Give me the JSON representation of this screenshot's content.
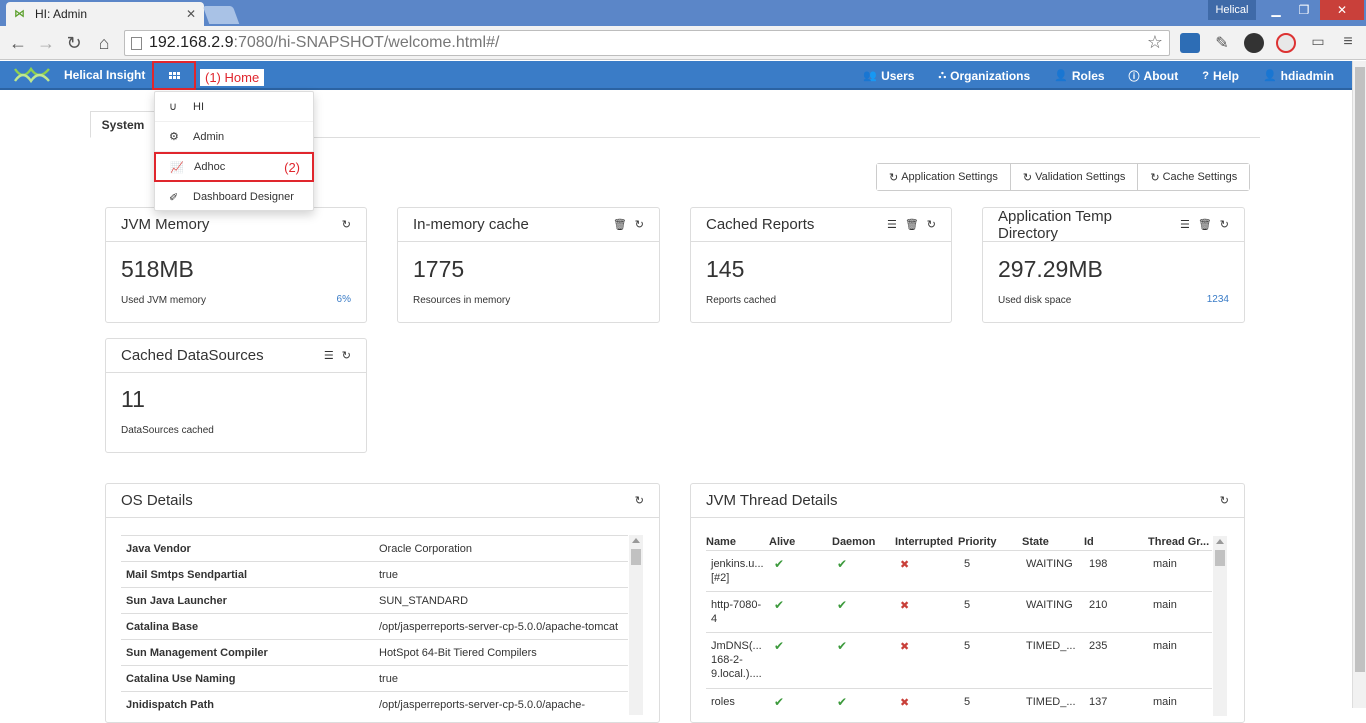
{
  "browser": {
    "tab_title": "HI: Admin",
    "tab_close": "✕",
    "profile_name": "Helical",
    "url_host": "192.168.2.9",
    "url_rest": ":7080/hi-SNAPSHOT/welcome.html#/"
  },
  "app": {
    "brand": "Helical Insight",
    "annotation_home": "(1) Home",
    "nav": {
      "users": "Users",
      "organizations": "Organizations",
      "roles": "Roles",
      "about": "About",
      "help": "Help",
      "user": "hdiadmin"
    },
    "colors": {
      "accent": "#3a7cc7",
      "highlight": "#e0262d",
      "ok": "#3c9a3c",
      "error": "#c9403a"
    }
  },
  "dropdown": {
    "items": [
      {
        "label": "HI",
        "icon": "magnet-icon"
      },
      {
        "label": "Admin",
        "icon": "cogs-icon"
      },
      {
        "label": "Adhoc",
        "icon": "line-chart-icon",
        "annotation": "(2)"
      },
      {
        "label": "Dashboard Designer",
        "icon": "magic-wand-icon"
      }
    ]
  },
  "tabs": {
    "system": "System"
  },
  "settings_buttons": {
    "application": "Application Settings",
    "validation": "Validation Settings",
    "cache": "Cache Settings"
  },
  "cards": {
    "jvm_memory": {
      "title": "JVM Memory",
      "value": "518MB",
      "label": "Used JVM memory",
      "extra": "6%"
    },
    "inmemory_cache": {
      "title": "In-memory cache",
      "value": "1775",
      "label": "Resources in memory"
    },
    "cached_reports": {
      "title": "Cached Reports",
      "value": "145",
      "label": "Reports cached"
    },
    "temp_dir": {
      "title": "Application Temp Directory",
      "value": "297.29MB",
      "label": "Used disk space",
      "extra": "1234"
    },
    "cached_datasources": {
      "title": "Cached DataSources",
      "value": "11",
      "label": "DataSources cached"
    }
  },
  "os_details": {
    "title": "OS Details",
    "rows": [
      {
        "key": "Java Vendor",
        "value": "Oracle Corporation"
      },
      {
        "key": "Mail Smtps Sendpartial",
        "value": "true"
      },
      {
        "key": "Sun Java Launcher",
        "value": "SUN_STANDARD"
      },
      {
        "key": "Catalina Base",
        "value": "/opt/jasperreports-server-cp-5.0.0/apache-tomcat"
      },
      {
        "key": "Sun Management Compiler",
        "value": "HotSpot 64-Bit Tiered Compilers"
      },
      {
        "key": "Catalina Use Naming",
        "value": "true"
      },
      {
        "key": "Jnidispatch Path",
        "value": "/opt/jasperreports-server-cp-5.0.0/apache-"
      }
    ]
  },
  "thread_details": {
    "title": "JVM Thread Details",
    "headers": [
      "Name",
      "Alive",
      "Daemon",
      "Interrupted",
      "Priority",
      "State",
      "Id",
      "Thread Gr..."
    ],
    "rows": [
      {
        "name": "jenkins.u...\n[#2]",
        "priority": "5",
        "state": "WAITING",
        "id": "198",
        "group": "main"
      },
      {
        "name": "http-7080-\n4",
        "priority": "5",
        "state": "WAITING",
        "id": "210",
        "group": "main"
      },
      {
        "name": "JmDNS(...\n168-2-\n9.local.)....",
        "priority": "5",
        "state": "TIMED_...",
        "id": "235",
        "group": "main"
      },
      {
        "name": "roles",
        "priority": "5",
        "state": "TIMED_...",
        "id": "137",
        "group": "main"
      }
    ]
  }
}
